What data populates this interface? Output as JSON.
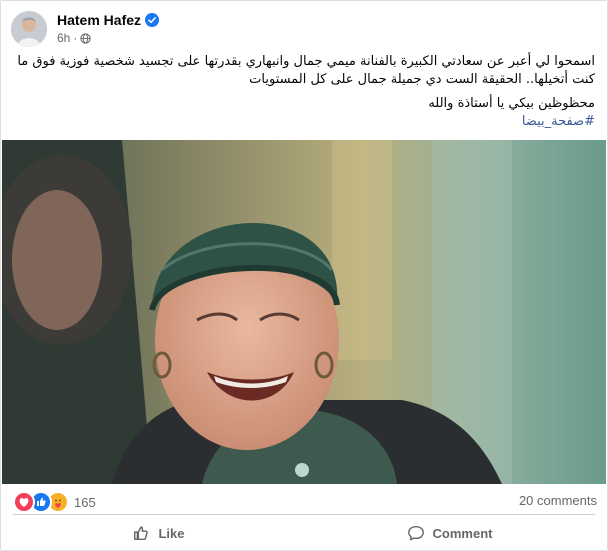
{
  "post": {
    "author": "Hatem Hafez",
    "time": "6h",
    "verified_icon": "verified-badge-icon",
    "audience_icon": "globe-icon",
    "text_line_1": "اسمحوا لي أعبر عن سعادتي الكبيرة بالفنانة ميمي جمال  وانبهاري بقدرتها على تجسيد شخصية فوزية فوق ما كنت أتخيلها.. الحقيقة الست دي جميلة جمال على كل المستويات",
    "text_line_2": "محظوظين بيكي يا أستاذة والله",
    "hashtag": "#صفحة_بيضا"
  },
  "stats": {
    "reaction_count": "165",
    "comments": "20 comments",
    "reaction_icons": [
      "love-reaction-icon",
      "like-reaction-icon",
      "care-reaction-icon"
    ]
  },
  "actions": {
    "like": "Like",
    "comment": "Comment"
  },
  "colors": {
    "accent": "#1877f2",
    "hashtag": "#385898",
    "secondary_text": "#65676b",
    "love": "#f33e58"
  }
}
